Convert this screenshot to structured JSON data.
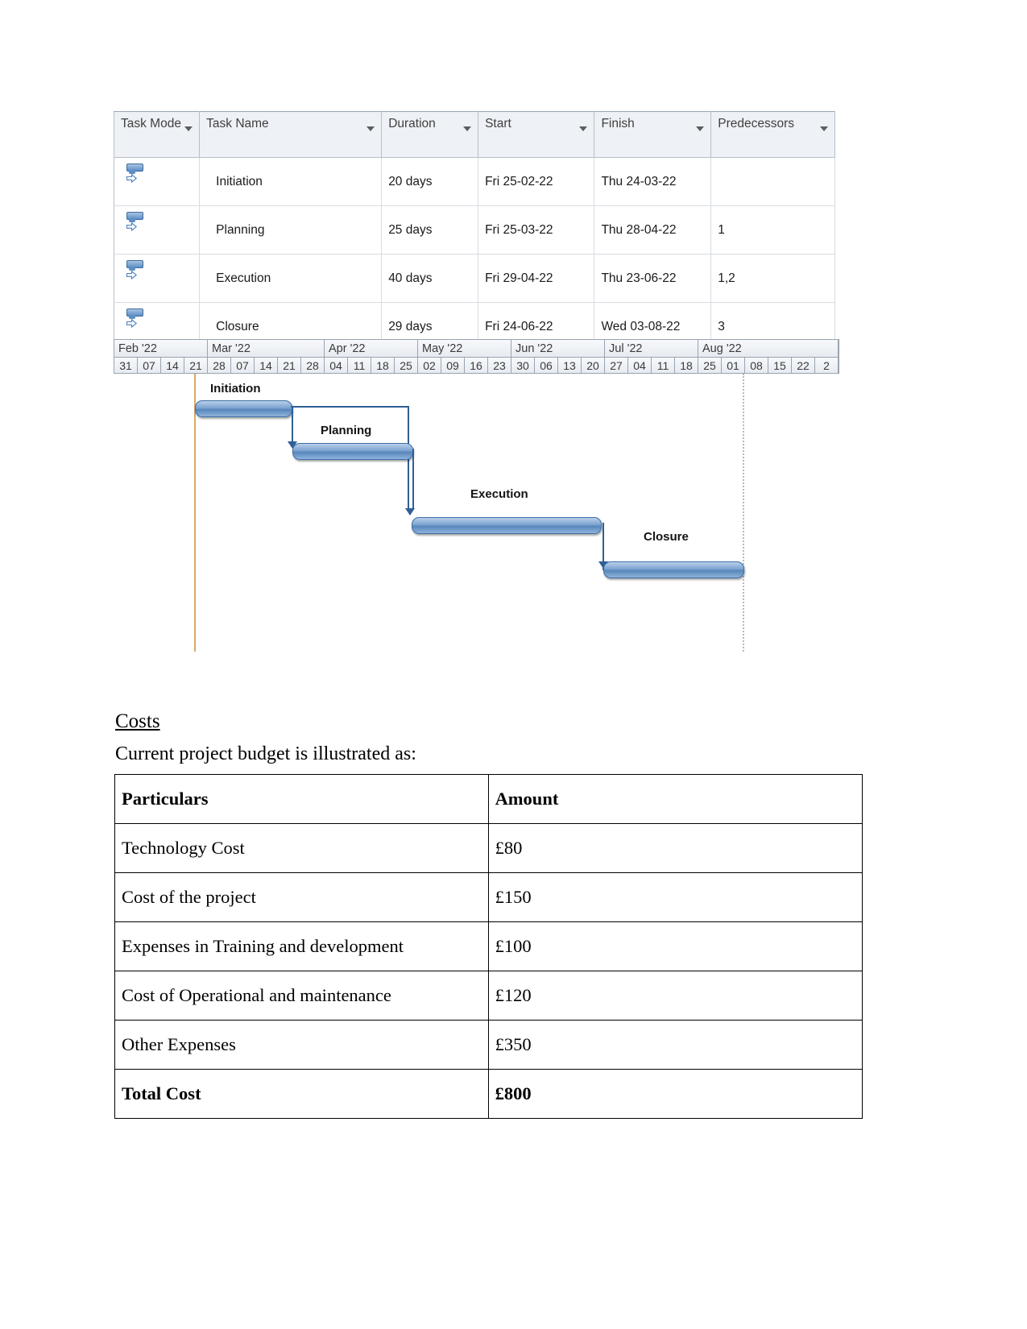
{
  "task_grid": {
    "columns": [
      {
        "label": "Task Mode",
        "has_filter": true
      },
      {
        "label": "Task Name",
        "has_filter": true
      },
      {
        "label": "Duration",
        "has_filter": true
      },
      {
        "label": "Start",
        "has_filter": true
      },
      {
        "label": "Finish",
        "has_filter": true
      },
      {
        "label": "Predecessors",
        "has_filter": true
      }
    ],
    "rows": [
      {
        "mode_icon": "auto-schedule-icon",
        "name": "Initiation",
        "duration": "20 days",
        "start": "Fri 25-02-22",
        "finish": "Thu 24-03-22",
        "predecessors": ""
      },
      {
        "mode_icon": "auto-schedule-icon",
        "name": "Planning",
        "duration": "25 days",
        "start": "Fri 25-03-22",
        "finish": "Thu 28-04-22",
        "predecessors": "1"
      },
      {
        "mode_icon": "auto-schedule-icon",
        "name": "Execution",
        "duration": "40 days",
        "start": "Fri 29-04-22",
        "finish": "Thu 23-06-22",
        "predecessors": "1,2"
      },
      {
        "mode_icon": "auto-schedule-icon",
        "name": "Closure",
        "duration": "29 days",
        "start": "Fri 24-06-22",
        "finish": "Wed 03-08-22",
        "predecessors": "3"
      }
    ]
  },
  "gantt": {
    "months": [
      "Feb '22",
      "Mar '22",
      "Apr '22",
      "May '22",
      "Jun '22",
      "Jul '22",
      "Aug '22"
    ],
    "weeks": [
      "31",
      "07",
      "14",
      "21",
      "28",
      "07",
      "14",
      "21",
      "28",
      "04",
      "11",
      "18",
      "25",
      "02",
      "09",
      "16",
      "23",
      "30",
      "06",
      "13",
      "20",
      "27",
      "04",
      "11",
      "18",
      "25",
      "01",
      "08",
      "15",
      "22",
      "2"
    ],
    "bars": [
      {
        "label": "Initiation",
        "duration": "20 days",
        "start": "Fri 25-02-22",
        "finish": "Thu 24-03-22"
      },
      {
        "label": "Planning",
        "duration": "25 days",
        "start": "Fri 25-03-22",
        "finish": "Thu 28-04-22"
      },
      {
        "label": "Execution",
        "duration": "40 days",
        "start": "Fri 29-04-22",
        "finish": "Thu 23-06-22"
      },
      {
        "label": "Closure",
        "duration": "29 days",
        "start": "Fri 24-06-22",
        "finish": "Wed 03-08-22"
      }
    ],
    "bar_color": "#5786bb",
    "link_color": "#2f5f96",
    "today_line_color": "#d9a96a"
  },
  "document": {
    "costs_heading": "Costs",
    "costs_intro": "Current project budget is illustrated as:"
  },
  "cost_table": {
    "headers": [
      "Particulars",
      "Amount"
    ],
    "rows": [
      {
        "particulars": "Technology Cost",
        "amount": "£80"
      },
      {
        "particulars": "Cost of the project",
        "amount": "£150"
      },
      {
        "particulars": "Expenses in Training and development",
        "amount": "£100"
      },
      {
        "particulars": "Cost of Operational and maintenance",
        "amount": "£120"
      },
      {
        "particulars": "Other Expenses",
        "amount": "£350"
      }
    ],
    "total": {
      "particulars": "Total Cost",
      "amount": "£800"
    }
  }
}
